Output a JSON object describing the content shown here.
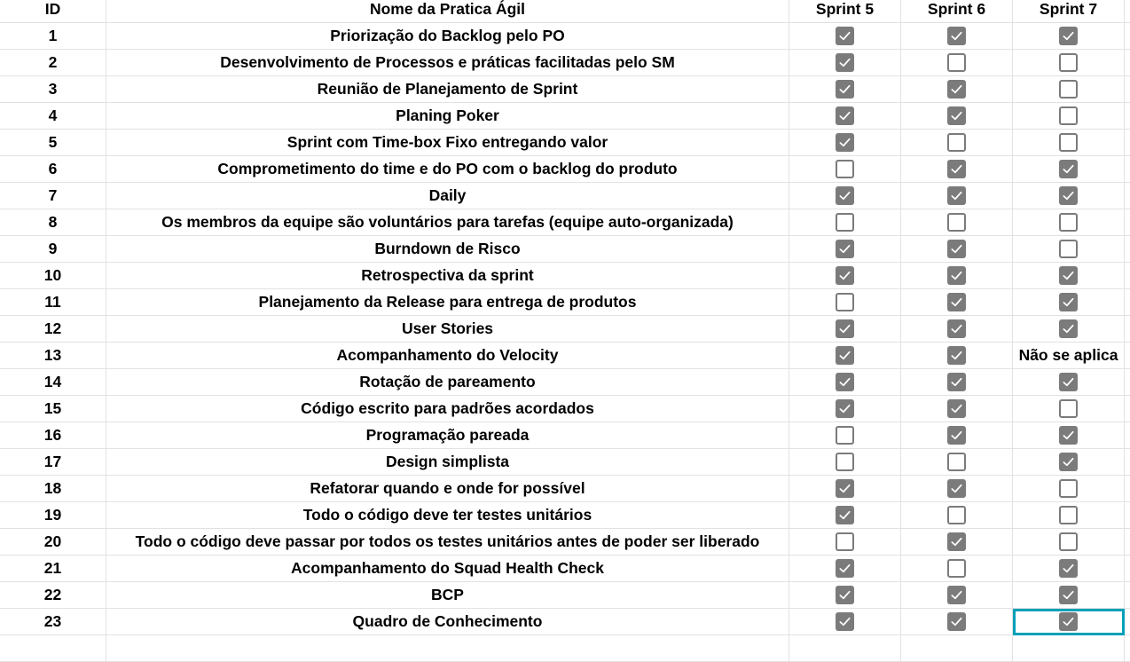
{
  "header": {
    "id": "ID",
    "name": "Nome da Pratica Ágil",
    "sprints": [
      "Sprint 5",
      "Sprint 6",
      "Sprint 7"
    ]
  },
  "colors": {
    "checkbox": "#7b7b7b",
    "selection": "#00a0b8",
    "grid": "#e2e2e2"
  },
  "selected_cell": {
    "row": 23,
    "column": "Sprint 7"
  },
  "rows": [
    {
      "id": "1",
      "name": "Priorização do Backlog pelo PO",
      "values": [
        true,
        true,
        true
      ]
    },
    {
      "id": "2",
      "name": "Desenvolvimento de Processos e práticas facilitadas pelo SM",
      "values": [
        true,
        false,
        false
      ]
    },
    {
      "id": "3",
      "name": "Reunião de Planejamento de Sprint",
      "values": [
        true,
        true,
        false
      ]
    },
    {
      "id": "4",
      "name": "Planing Poker",
      "values": [
        true,
        true,
        false
      ]
    },
    {
      "id": "5",
      "name": "Sprint com Time-box Fixo entregando valor",
      "values": [
        true,
        false,
        false
      ]
    },
    {
      "id": "6",
      "name": "Comprometimento do time e do PO com o backlog do produto",
      "values": [
        false,
        true,
        true
      ]
    },
    {
      "id": "7",
      "name": "Daily",
      "values": [
        true,
        true,
        true
      ]
    },
    {
      "id": "8",
      "name": "Os membros da equipe são voluntários para tarefas (equipe auto-organizada)",
      "values": [
        false,
        false,
        false
      ]
    },
    {
      "id": "9",
      "name": "Burndown de Risco",
      "values": [
        true,
        true,
        false
      ]
    },
    {
      "id": "10",
      "name": "Retrospectiva da sprint",
      "values": [
        true,
        true,
        true
      ]
    },
    {
      "id": "11",
      "name": "Planejamento da Release para entrega de produtos",
      "values": [
        false,
        true,
        true
      ]
    },
    {
      "id": "12",
      "name": "User Stories",
      "values": [
        true,
        true,
        true
      ]
    },
    {
      "id": "13",
      "name": "Acompanhamento do Velocity",
      "values": [
        true,
        true,
        "Não se aplica"
      ]
    },
    {
      "id": "14",
      "name": "Rotação de pareamento",
      "values": [
        true,
        true,
        true
      ]
    },
    {
      "id": "15",
      "name": "Código escrito para padrões acordados",
      "values": [
        true,
        true,
        false
      ]
    },
    {
      "id": "16",
      "name": "Programação pareada",
      "values": [
        false,
        true,
        true
      ]
    },
    {
      "id": "17",
      "name": "Design simplista",
      "values": [
        false,
        false,
        true
      ]
    },
    {
      "id": "18",
      "name": "Refatorar quando e onde for possível",
      "values": [
        true,
        true,
        false
      ]
    },
    {
      "id": "19",
      "name": "Todo o código deve ter testes unitários",
      "values": [
        true,
        false,
        false
      ]
    },
    {
      "id": "20",
      "name": "Todo o código deve passar por todos os testes unitários antes de poder ser liberado",
      "values": [
        false,
        true,
        false
      ]
    },
    {
      "id": "21",
      "name": "Acompanhamento do Squad Health Check",
      "values": [
        true,
        false,
        true
      ]
    },
    {
      "id": "22",
      "name": "BCP",
      "values": [
        true,
        true,
        true
      ]
    },
    {
      "id": "23",
      "name": "Quadro de Conhecimento",
      "values": [
        true,
        true,
        true
      ]
    }
  ]
}
